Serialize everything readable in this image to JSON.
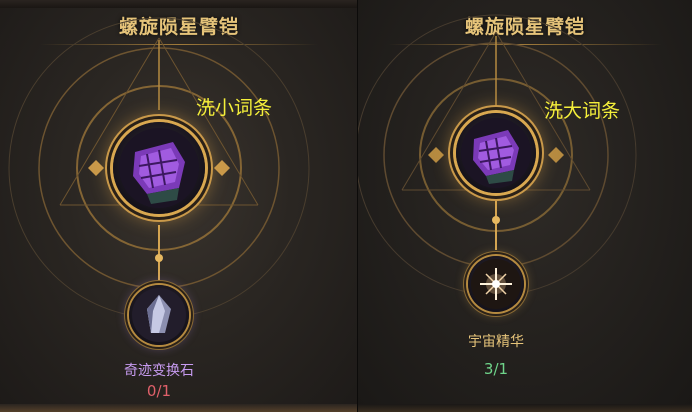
{
  "left_panel": {
    "title": "螺旋陨星臂铠",
    "annotation": "洗小词条",
    "material_name": "奇迹变换石",
    "material_count": "0/1",
    "material_icon": "crystal-stone-icon"
  },
  "right_panel": {
    "title": "螺旋陨星臂铠",
    "annotation": "洗大词条",
    "material_name": "宇宙精华",
    "material_count": "3/1",
    "material_icon": "cosmic-essence-icon"
  },
  "colors": {
    "title_gold": "#e6c47a",
    "annotation_yellow": "#f4ef3a",
    "count_insufficient": "#e0606a",
    "count_sufficient": "#6fd48a",
    "name_purple": "#c79bf0",
    "name_gold": "#e6c47a"
  }
}
